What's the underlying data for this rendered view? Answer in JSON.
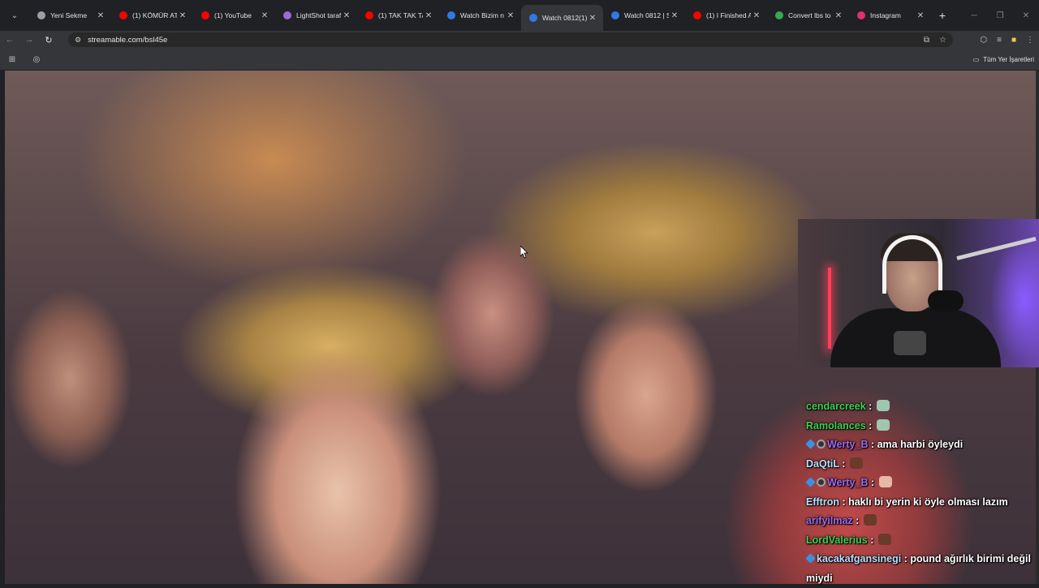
{
  "browser": {
    "tabs": [
      {
        "title": "Yeni Sekme",
        "favicon": "chrome-icon",
        "color": "#9aa0a6",
        "active": false
      },
      {
        "title": "(1) KÖMÜR AT!",
        "favicon": "youtube-icon",
        "color": "#ff0000",
        "active": false
      },
      {
        "title": "(1) YouTube",
        "favicon": "youtube-icon",
        "color": "#ff0000",
        "active": false
      },
      {
        "title": "LightShot taraf",
        "favicon": "feather-icon",
        "color": "#9b6bd8",
        "active": false
      },
      {
        "title": "(1) TAK TAK TA",
        "favicon": "youtube-icon",
        "color": "#ff0000",
        "active": false
      },
      {
        "title": "Watch Bizim n",
        "favicon": "streamable-icon",
        "color": "#2f7ae5",
        "active": false
      },
      {
        "title": "Watch 0812(1)",
        "favicon": "streamable-icon",
        "color": "#2f7ae5",
        "active": true
      },
      {
        "title": "Watch 0812 | S",
        "favicon": "streamable-icon",
        "color": "#2f7ae5",
        "active": false
      },
      {
        "title": "(1) I Finished A",
        "favicon": "youtube-icon",
        "color": "#ff0000",
        "active": false
      },
      {
        "title": "Convert lbs to",
        "favicon": "convert-icon",
        "color": "#34a853",
        "active": false
      },
      {
        "title": "Instagram",
        "favicon": "instagram-icon",
        "color": "#e1306c",
        "active": false
      }
    ],
    "url": "streamable.com/bsl45e",
    "bookmarks_label": "Tüm Yer İşaretleri"
  },
  "chat": {
    "messages": [
      {
        "user": "cendarcreek",
        "user_color": "#39d353",
        "text": "",
        "emote_color": "#9fc7b0",
        "badges": []
      },
      {
        "user": "Ramolances",
        "user_color": "#39d353",
        "text": "",
        "emote_color": "#9fc7b0",
        "badges": []
      },
      {
        "user": "Werty_B",
        "user_color": "#9b6bf2",
        "text": "ama harbi öyleydi",
        "emote_color": "",
        "badges": [
          "cube",
          "circle"
        ]
      },
      {
        "user": "DaQtiL",
        "user_color": "#b7e1ff",
        "text": "",
        "emote_color": "#6b3a2a",
        "badges": []
      },
      {
        "user": "Werty_B",
        "user_color": "#9b6bf2",
        "text": "",
        "emote_color": "#e7b8a8",
        "badges": [
          "cube",
          "circle"
        ]
      },
      {
        "user": "Efftron",
        "user_color": "#b7e1ff",
        "text": "haklı bi yerin ki öyle olması lazım",
        "emote_color": "",
        "badges": []
      },
      {
        "user": "arifyilmaz",
        "user_color": "#9b6bf2",
        "text": "",
        "emote_color": "#6b3a2a",
        "badges": []
      },
      {
        "user": "LordValerius",
        "user_color": "#39d353",
        "text": "",
        "emote_color": "#6b3a2a",
        "badges": []
      },
      {
        "user": "kacakafgansinegi",
        "user_color": "#b7e1ff",
        "text": "pound ağırlık birimi değil miydi",
        "emote_color": "",
        "badges": [
          "cube"
        ]
      }
    ]
  }
}
